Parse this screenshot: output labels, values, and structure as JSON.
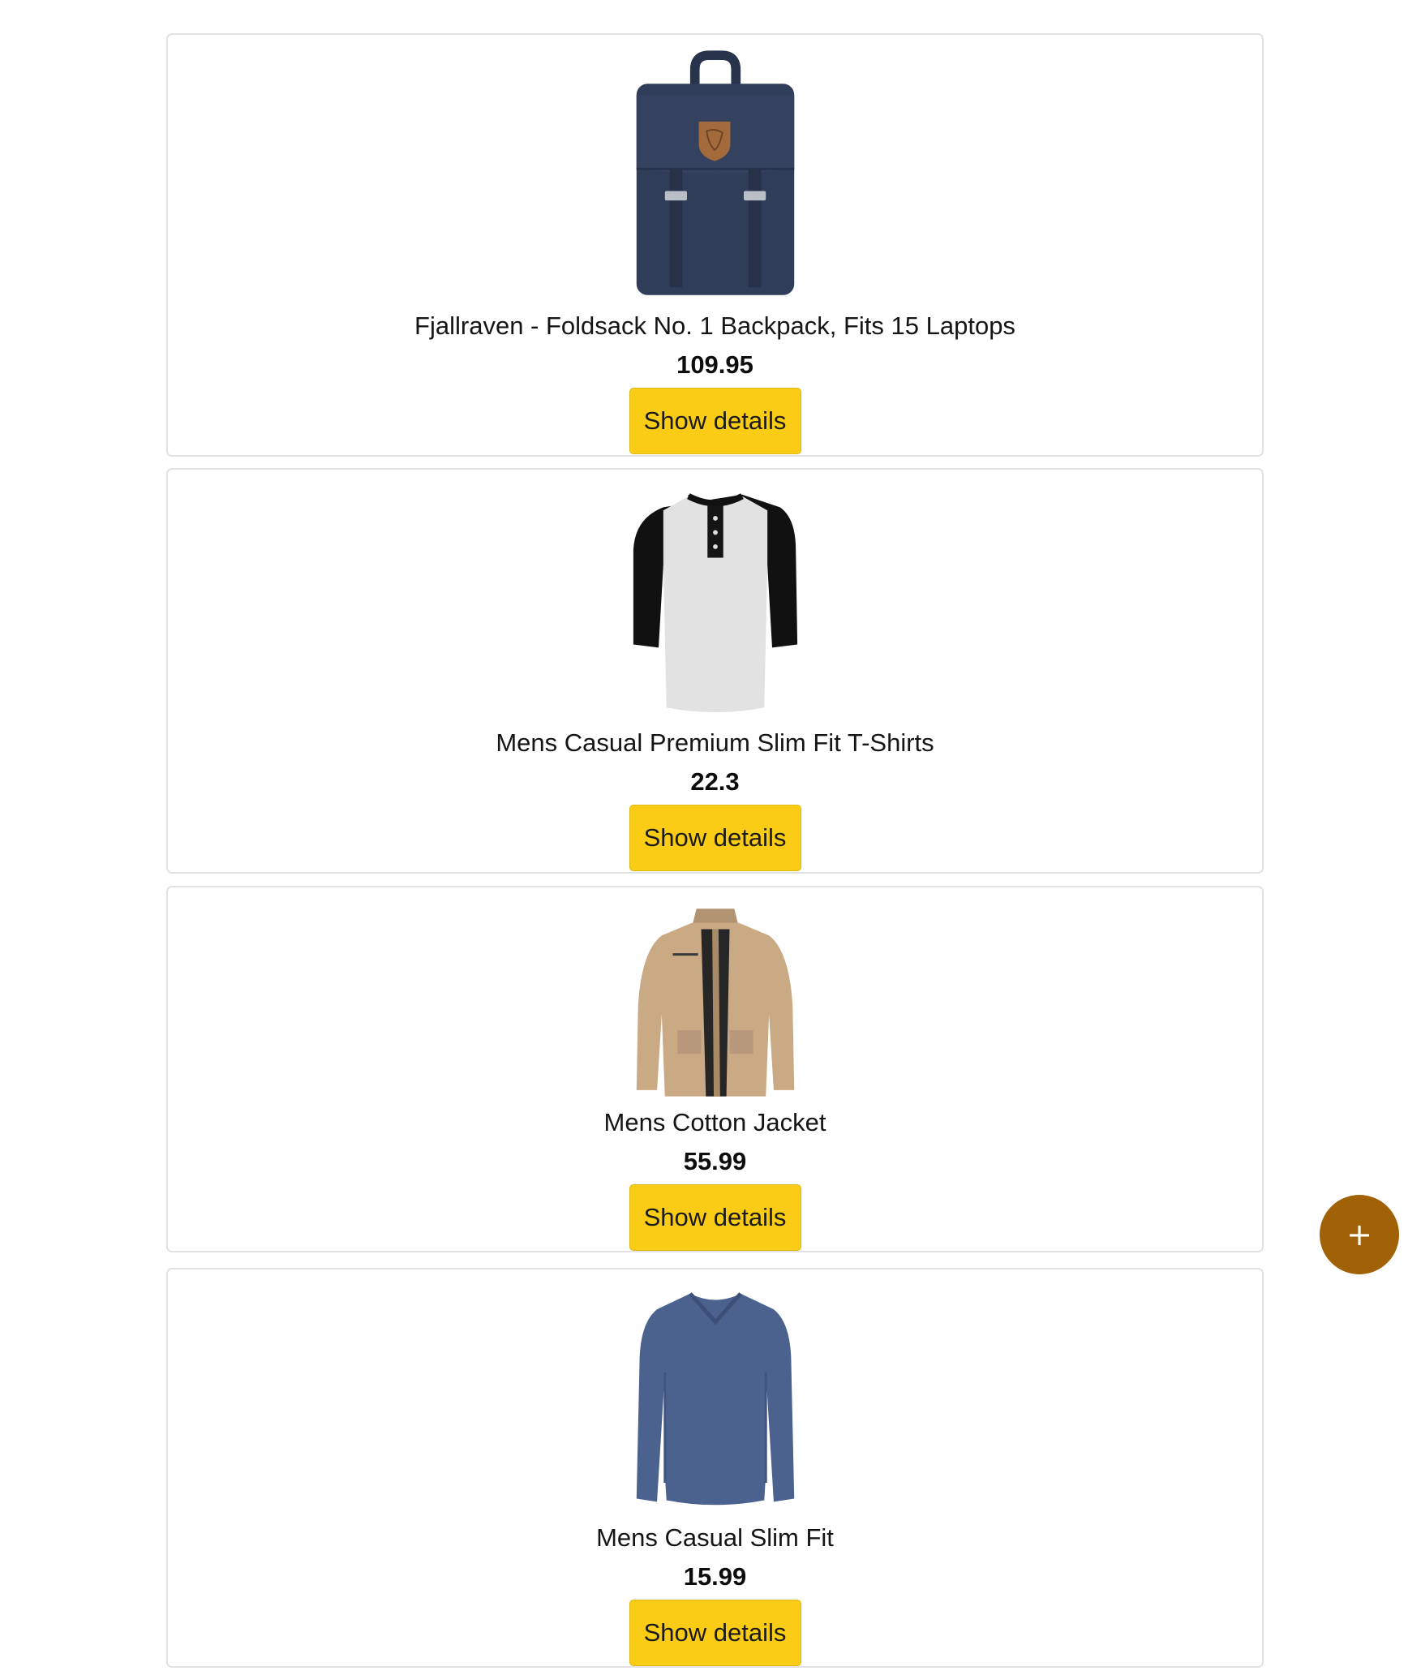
{
  "products": [
    {
      "title": "Fjallraven - Foldsack No. 1 Backpack, Fits 15 Laptops",
      "price": "109.95",
      "button_label": "Show details",
      "image": "navy-backpack-image"
    },
    {
      "title": "Mens Casual Premium Slim Fit T-Shirts",
      "price": "22.3",
      "button_label": "Show details",
      "image": "raglan-henley-tshirt-image"
    },
    {
      "title": "Mens Cotton Jacket",
      "price": "55.99",
      "button_label": "Show details",
      "image": "khaki-cotton-jacket-image"
    },
    {
      "title": "Mens Casual Slim Fit",
      "price": "15.99",
      "button_label": "Show details",
      "image": "blue-long-sleeve-shirt-image"
    }
  ],
  "fab": {
    "label": "+",
    "icon": "plus-icon",
    "color": "#a16207"
  },
  "colors": {
    "button": "#facc15",
    "card_border": "#e2e2e2"
  }
}
